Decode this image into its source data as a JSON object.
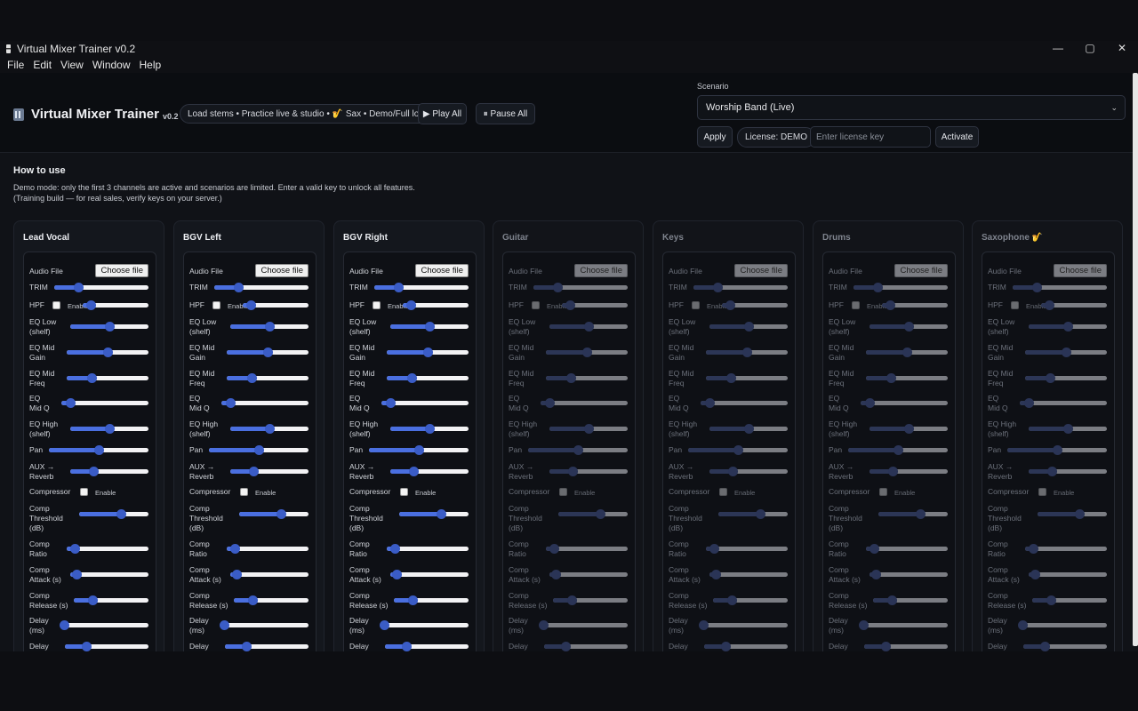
{
  "window": {
    "title": "Virtual Mixer Trainer v0.2",
    "controls": [
      "—",
      "▢",
      "✕"
    ]
  },
  "menu": [
    "File",
    "Edit",
    "View",
    "Window",
    "Help"
  ],
  "header": {
    "title": "Virtual Mixer Trainer",
    "version": "v0.2",
    "tagline": "Load stems • Practice live & studio • 🎷 Sax • Demo/Full lock",
    "play_all": "▶ Play All",
    "pause_all": "⏸ Pause All",
    "scenario_label": "Scenario",
    "scenario_value": "Worship Band (Live)",
    "apply": "Apply",
    "license_status": "License: DEMO",
    "license_placeholder": "Enter license key",
    "activate": "Activate"
  },
  "howto": {
    "title": "How to use",
    "line1": "Demo mode: only the first 3 channels are active and scenarios are limited. Enter a valid key to unlock all features.",
    "line2": "(Training build — for real sales, verify keys on your server.)"
  },
  "labels": {
    "audio_file": "Audio File",
    "choose_file": "Choose file",
    "trim": "TRIM",
    "hpf": "HPF",
    "enable": "Enable",
    "eq_low_1": "EQ Low",
    "eq_low_2": "(shelf)",
    "eq_mid_gain_1": "EQ Mid",
    "eq_mid_gain_2": "Gain",
    "eq_mid_freq_1": "EQ Mid",
    "eq_mid_freq_2": "Freq",
    "eq_q_1": "EQ",
    "eq_q_2": "Mid Q",
    "eq_high_1": "EQ High",
    "eq_high_2": "(shelf)",
    "pan": "Pan",
    "aux_1": "AUX →",
    "aux_2": "Reverb",
    "compressor": "Compressor",
    "thr_1": "Comp",
    "thr_2": "Threshold",
    "thr_3": "(dB)",
    "ratio_1": "Comp",
    "ratio_2": "Ratio",
    "attack_1": "Comp",
    "attack_2": "Attack (s)",
    "release_1": "Comp",
    "release_2": "Release (s)",
    "delay_1": "Delay",
    "delay_2": "(ms)",
    "delay2_1": "Delay"
  },
  "channels": [
    {
      "name": "Lead Vocal",
      "active": true
    },
    {
      "name": "BGV Left",
      "active": true
    },
    {
      "name": "BGV Right",
      "active": true
    },
    {
      "name": "Guitar",
      "active": false
    },
    {
      "name": "Keys",
      "active": false
    },
    {
      "name": "Drums",
      "active": false
    },
    {
      "name": "Saxophone 🎷",
      "active": false
    }
  ],
  "slider_values": {
    "trim": 0.25,
    "hpf": 0.12,
    "eq_low": 0.5,
    "eq_mid_gain": 0.5,
    "eq_mid_freq": 0.3,
    "eq_q": 0.1,
    "eq_high": 0.5,
    "pan": 0.5,
    "aux": 0.3,
    "threshold": 0.6,
    "ratio": 0.1,
    "attack": 0.08,
    "release": 0.25,
    "delay": 0.0,
    "delay2": 0.25
  },
  "colors": {
    "accent": "#4a6fe0",
    "panel": "#14171d",
    "background": "#101217"
  }
}
